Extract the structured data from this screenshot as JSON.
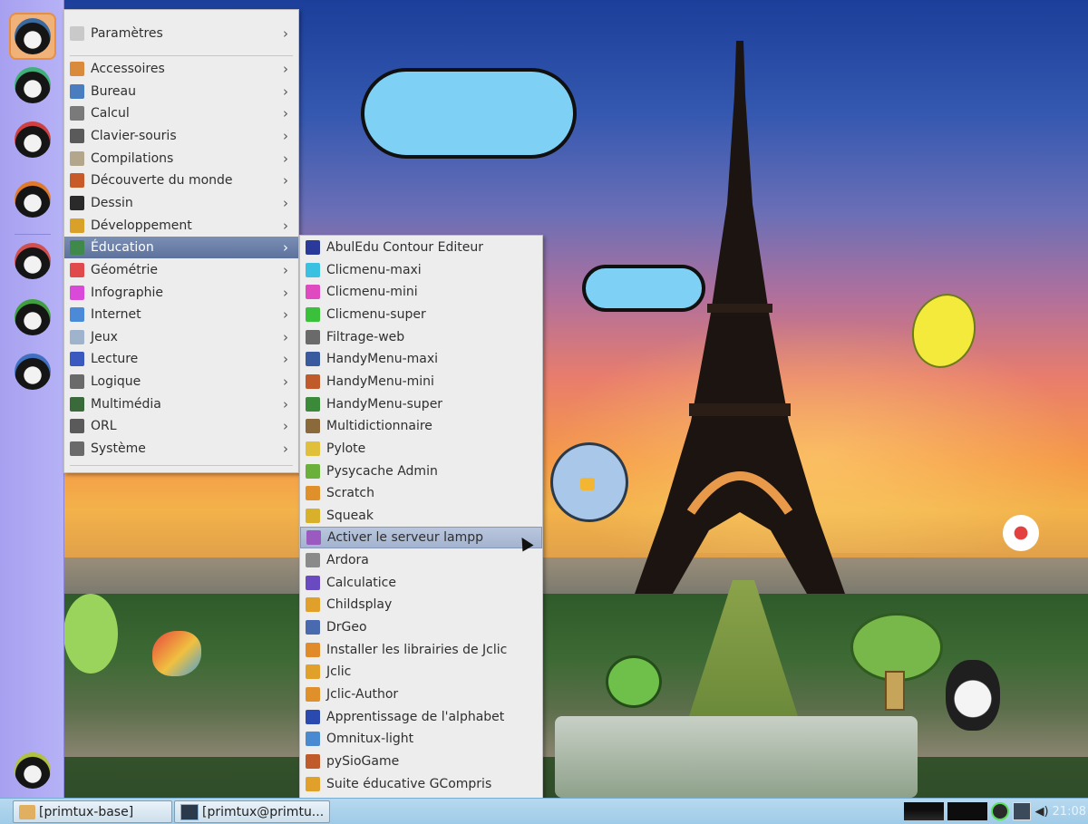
{
  "main_menu": {
    "items": [
      {
        "label": "Paramètres",
        "color": "#c9c9c9"
      },
      {
        "label": "Accessoires",
        "color": "#d98a3a"
      },
      {
        "label": "Bureau",
        "color": "#4a7cc0"
      },
      {
        "label": "Calcul",
        "color": "#7a7a7a"
      },
      {
        "label": "Clavier-souris",
        "color": "#5a5a5a"
      },
      {
        "label": "Compilations",
        "color": "#b4a68a"
      },
      {
        "label": "Découverte du monde",
        "color": "#c85a2a"
      },
      {
        "label": "Dessin",
        "color": "#2a2a2a"
      },
      {
        "label": "Développement",
        "color": "#d9a02a"
      },
      {
        "label": "Éducation",
        "color": "#3f8a4a"
      },
      {
        "label": "Géométrie",
        "color": "#e04a4a"
      },
      {
        "label": "Infographie",
        "color": "#d94ad9"
      },
      {
        "label": "Internet",
        "color": "#4a8ad9"
      },
      {
        "label": "Jeux",
        "color": "#9fb4cc"
      },
      {
        "label": "Lecture",
        "color": "#3a5ac0"
      },
      {
        "label": "Logique",
        "color": "#6a6a6a"
      },
      {
        "label": "Multimédia",
        "color": "#3a6a3a"
      },
      {
        "label": "ORL",
        "color": "#5a5a5a"
      },
      {
        "label": "Système",
        "color": "#6a6a6a"
      }
    ],
    "highlighted_index": 9
  },
  "education_submenu": {
    "items": [
      {
        "label": "AbulEdu Contour Editeur",
        "color": "#2a3a9a"
      },
      {
        "label": "Clicmenu-maxi",
        "color": "#3ac0e0"
      },
      {
        "label": "Clicmenu-mini",
        "color": "#e04ac0"
      },
      {
        "label": "Clicmenu-super",
        "color": "#3ac03a"
      },
      {
        "label": "Filtrage-web",
        "color": "#6a6a6a"
      },
      {
        "label": "HandyMenu-maxi",
        "color": "#3a5aa0"
      },
      {
        "label": "HandyMenu-mini",
        "color": "#c05a2a"
      },
      {
        "label": "HandyMenu-super",
        "color": "#3a8a3a"
      },
      {
        "label": "Multidictionnaire",
        "color": "#8a6a3a"
      },
      {
        "label": "Pylote",
        "color": "#e0c03a"
      },
      {
        "label": "Pysycache Admin",
        "color": "#6ab03a"
      },
      {
        "label": "Scratch",
        "color": "#e0902a"
      },
      {
        "label": "Squeak",
        "color": "#d9b02a"
      },
      {
        "label": "Activer le serveur lampp",
        "color": "#9a5ac0"
      },
      {
        "label": "Ardora",
        "color": "#8a8a8a"
      },
      {
        "label": "Calculatice",
        "color": "#6a4ac0"
      },
      {
        "label": "Childsplay",
        "color": "#e0a02a"
      },
      {
        "label": "DrGeo",
        "color": "#4a6ab0"
      },
      {
        "label": "Installer les librairies de Jclic",
        "color": "#e08a2a"
      },
      {
        "label": "Jclic",
        "color": "#e0a02a"
      },
      {
        "label": "Jclic-Author",
        "color": "#e0902a"
      },
      {
        "label": "Apprentissage de l'alphabet",
        "color": "#2a4ab0"
      },
      {
        "label": "Omnitux-light",
        "color": "#4a8ad0"
      },
      {
        "label": "pySioGame",
        "color": "#c05a2a"
      },
      {
        "label": "Suite éducative GCompris",
        "color": "#e0a02a"
      }
    ],
    "selected_index": 13
  },
  "launcher": {
    "buttons": [
      {
        "name": "menu-penguin",
        "color": "#3a6aa0"
      },
      {
        "name": "primtux-settings",
        "color": "#40b07a"
      },
      {
        "name": "parrot-app",
        "color": "#d04040"
      },
      {
        "name": "firefox",
        "color": "#e07a2a"
      },
      {
        "name": "session-mini",
        "color": "#d05050"
      },
      {
        "name": "session-super",
        "color": "#40a040"
      },
      {
        "name": "session-maxi",
        "color": "#4070c0"
      },
      {
        "name": "session-poeme",
        "color": "#b0c040"
      }
    ]
  },
  "taskbar": {
    "tasks": [
      {
        "label": "[primtux-base]"
      },
      {
        "label": "[primtux@primtu..."
      }
    ],
    "clock": "21:08"
  }
}
